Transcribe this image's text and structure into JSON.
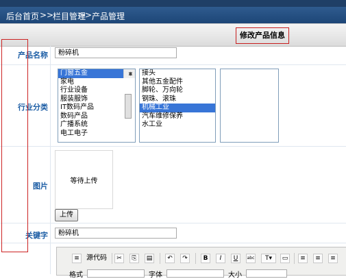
{
  "breadcrumb": {
    "home": "后台首页",
    "sep1": ">>",
    "section": "栏目管理",
    "sep2": ">>",
    "page": "产品管理"
  },
  "header": {
    "title": "修改产品信息"
  },
  "labels": {
    "name": "产品名称",
    "industry": "行业分类",
    "image": "图片",
    "keywords": "关键字"
  },
  "form": {
    "name_value": "粉碎机",
    "keywords_value": "粉碎机",
    "list1": [
      "门窗五金",
      "家电",
      "行业设备",
      "服装服饰",
      "IT数码产品",
      "数码产品",
      "广播系统",
      "电工电子"
    ],
    "list1_selected": "门窗五金",
    "list2": [
      "接头",
      "其他五金配件",
      "脚轮、万向轮",
      "钢珠、滚珠",
      "机械工业",
      "汽车维修保养",
      "水工业"
    ],
    "list2_selected": "机械工业",
    "image_placeholder": "等待上传",
    "upload_label": "上传"
  },
  "editor": {
    "source_label": "源代码",
    "format_label": "格式",
    "font_label": "字体",
    "size_label": "大小"
  },
  "colors": {
    "accent": "#1d4677",
    "label": "#1d5ea5",
    "highlight": "#c71d1d"
  }
}
